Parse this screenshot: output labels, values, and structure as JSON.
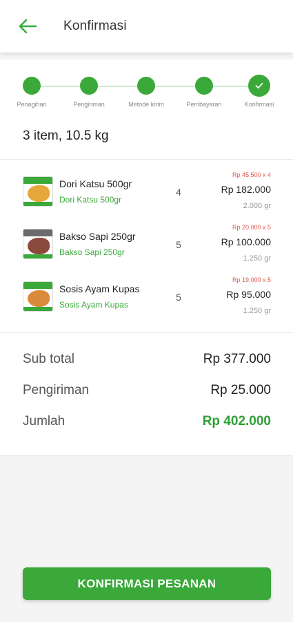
{
  "header": {
    "title": "Konfirmasi",
    "back_icon": "arrow-left-icon",
    "accent": "#3aa93a"
  },
  "stepper": {
    "steps": [
      {
        "label": "Penagihan"
      },
      {
        "label": "Pengiriman"
      },
      {
        "label": "Metode kirim"
      },
      {
        "label": "Pembayaran"
      },
      {
        "label": "Konfirmasi"
      }
    ],
    "current_step_icon": "check-icon"
  },
  "summary": "3 item, 10.5 kg",
  "items": [
    {
      "name": "Dori Katsu 500gr",
      "subtitle": "Dori Katsu 500gr",
      "qty": "4",
      "unit_price": "Rp 45.500 x 4",
      "price": "Rp 182.000",
      "weight": "2.000 gr"
    },
    {
      "name": "Bakso Sapi 250gr",
      "subtitle": "Bakso Sapi 250gr",
      "qty": "5",
      "unit_price": "Rp 20.000 x 5",
      "price": "Rp 100.000",
      "weight": "1.250 gr"
    },
    {
      "name": "Sosis Ayam Kupas",
      "subtitle": "Sosis Ayam Kupas",
      "qty": "5",
      "unit_price": "Rp 19.000 x 5",
      "price": "Rp 95.000",
      "weight": "1.250 gr"
    }
  ],
  "totals": {
    "subtotal_label": "Sub total",
    "subtotal_value": "Rp 377.000",
    "shipping_label": "Pengiriman",
    "shipping_value": "Rp 25.000",
    "total_label": "Jumlah",
    "total_value": "Rp 402.000"
  },
  "confirm_button": "KONFIRMASI PESANAN"
}
